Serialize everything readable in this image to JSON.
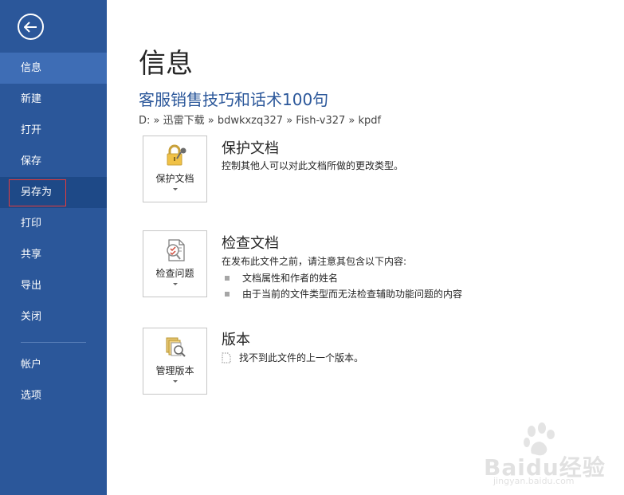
{
  "sidebar": {
    "items": [
      {
        "label": "信息"
      },
      {
        "label": "新建"
      },
      {
        "label": "打开"
      },
      {
        "label": "保存"
      },
      {
        "label": "另存为"
      },
      {
        "label": "打印"
      },
      {
        "label": "共享"
      },
      {
        "label": "导出"
      },
      {
        "label": "关闭"
      }
    ],
    "bottom_items": [
      {
        "label": "帐户"
      },
      {
        "label": "选项"
      }
    ],
    "back_icon": "back-arrow-icon",
    "colors": {
      "bg": "#2b579a",
      "active": "#3e6db5",
      "hover": "#1e4987",
      "outline": "#e63c3c"
    }
  },
  "main": {
    "page_title": "信息",
    "doc_title": "客服销售技巧和话术100句",
    "breadcrumb": "D: » 迅雷下载 » bdwkxzq327 » Fish-v327 » kpdf",
    "protect": {
      "button_label": "保护文档",
      "heading": "保护文档",
      "description": "控制其他人可以对此文档所做的更改类型。",
      "icon": "lock-key-icon"
    },
    "inspect": {
      "button_label": "检查问题",
      "heading": "检查文档",
      "description": "在发布此文件之前，请注意其包含以下内容:",
      "bullets": [
        "文档属性和作者的姓名",
        "由于当前的文件类型而无法检查辅助功能问题的内容"
      ],
      "icon": "inspect-document-icon"
    },
    "versions": {
      "button_label": "管理版本",
      "heading": "版本",
      "description": "找不到此文件的上一个版本。",
      "icon": "manage-versions-icon"
    }
  },
  "watermark": {
    "text": "Baidu经验",
    "url": "jingyan.baidu.com"
  }
}
